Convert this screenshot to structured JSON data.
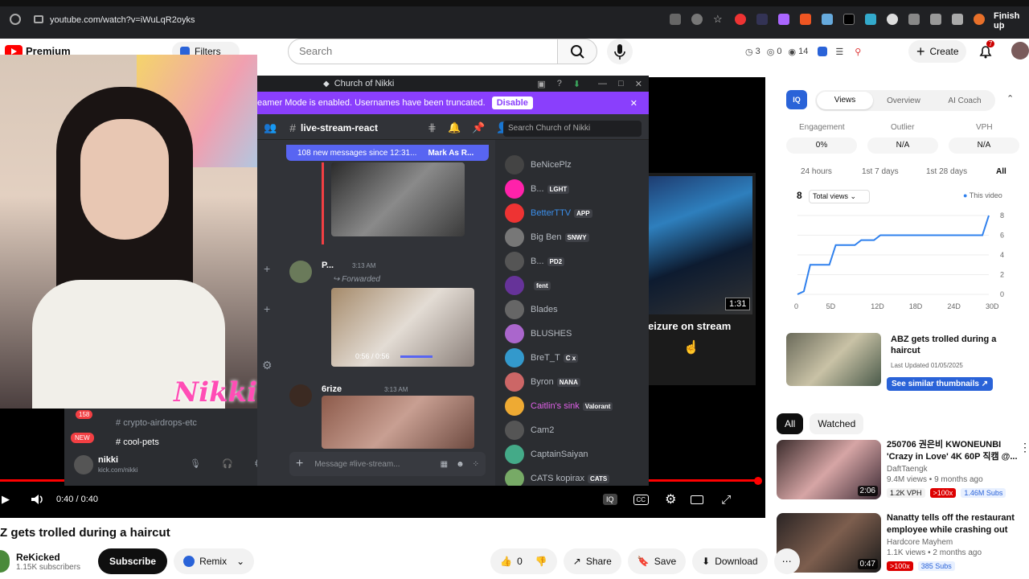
{
  "browser": {
    "url": "youtube.com/watch?v=iWuLqR2oyks",
    "finish_label": "Finish up"
  },
  "youtube": {
    "logo": "Premium",
    "filters_label": "Filters",
    "search_placeholder": "Search",
    "stats": [
      "3",
      "0",
      "14"
    ],
    "create_label": "Create",
    "bell_count": "7"
  },
  "player": {
    "time": "0:40 / 0:40",
    "related_title": "eizure on stream",
    "related_duration": "1:31"
  },
  "discord": {
    "server": "Church of Nikki",
    "banner_text": "eamer Mode is enabled. Usernames have been truncated.",
    "banner_button": "Disable",
    "channel": "live-stream-react",
    "search_placeholder": "Search Church of Nikki",
    "new_messages": "108 new messages since 12:31...",
    "mark_as_read": "Mark As R...",
    "messages": [
      {
        "author": "P...",
        "time": "3:13 AM",
        "note": "Forwarded",
        "video_time": "0:56 / 0:56"
      },
      {
        "author": "6rize",
        "time": "3:13 AM"
      }
    ],
    "input_placeholder": "Message #live-stream...",
    "members": [
      {
        "name": "BeNicePlz",
        "tag": "",
        "color": "#b5bac1"
      },
      {
        "name": "B...",
        "tag": "LGHT",
        "color": "#b5bac1"
      },
      {
        "name": "BetterTTV",
        "tag": "APP",
        "color": "#3b8eea"
      },
      {
        "name": "Big Ben",
        "tag": "SNWY",
        "color": "#b5bac1"
      },
      {
        "name": "B...",
        "tag": "PD2",
        "color": "#b5bac1"
      },
      {
        "name": "",
        "tag": "fent",
        "color": "#b5bac1"
      },
      {
        "name": "Blades",
        "tag": "",
        "color": "#b5bac1"
      },
      {
        "name": "BLUSHES",
        "tag": "",
        "color": "#b5bac1"
      },
      {
        "name": "BreT_T",
        "tag": "C x",
        "color": "#b5bac1"
      },
      {
        "name": "Byron",
        "tag": "NANA",
        "color": "#b5bac1"
      },
      {
        "name": "Caitlin's sink",
        "tag": "Valorant",
        "color": "#e061e8"
      },
      {
        "name": "Cam2",
        "tag": "",
        "color": "#b5bac1"
      },
      {
        "name": "CaptainSaiyan",
        "tag": "",
        "color": "#b5bac1"
      },
      {
        "name": "CATS kopirax",
        "tag": "CATS",
        "color": "#b5bac1"
      }
    ],
    "sidebar_channels": [
      "crypto-airdrops-etc",
      "cool-pets"
    ],
    "badge_158": "158",
    "badge_new": "NEW",
    "user_name": "nikki",
    "user_sub": "kick.com/nikki"
  },
  "webcam": {
    "overlay_name": "Nikki"
  },
  "iq_panel": {
    "tabs": [
      "Views",
      "Overview",
      "AI Coach"
    ],
    "metric_labels": [
      "Engagement",
      "Outlier",
      "VPH"
    ],
    "metric_values": [
      "0%",
      "N/A",
      "N/A"
    ],
    "ranges": [
      "24 hours",
      "1st 7 days",
      "1st 28 days",
      "All"
    ],
    "total_count": "8",
    "total_select": "Total views",
    "legend": "This video"
  },
  "chart_data": {
    "type": "line",
    "x_ticks": [
      "0",
      "5D",
      "12D",
      "18D",
      "24D",
      "30D"
    ],
    "y_ticks": [
      0,
      2,
      4,
      6,
      8
    ],
    "ylim": [
      0,
      8
    ],
    "series": [
      {
        "name": "This video",
        "x": [
          0,
          1,
          2,
          5,
          6,
          9,
          10,
          12,
          13,
          29,
          30
        ],
        "y": [
          0,
          0.3,
          3,
          3,
          5,
          5,
          5.5,
          5.5,
          6,
          6,
          8
        ]
      }
    ]
  },
  "similar": {
    "title": "ABZ gets trolled during a haircut",
    "updated": "Last Updated 01/05/2025",
    "button": "See similar thumbnails"
  },
  "chips": [
    "All",
    "Watched"
  ],
  "recommendations": [
    {
      "title": "250706 권은비 KWONEUNBI 'Crazy in Love' 4K 60P 직캠 @...",
      "channel": "DaftTaengk",
      "meta": "9.4M views • 9 months ago",
      "vph": "1.2K VPH",
      "outlier": ">100x",
      "subs": "1.46M Subs",
      "duration": "2:06"
    },
    {
      "title": "Nanatty tells off the restaurant employee while crashing out",
      "channel": "Hardcore Mayhem",
      "meta": "1.1K views • 2 months ago",
      "vph": "",
      "outlier": ">100x",
      "subs": "385 Subs",
      "duration": "0:47"
    }
  ],
  "video": {
    "title": "Z gets trolled during a haircut",
    "channel": "ReKicked",
    "subs": "1.15K subscribers",
    "subscribe": "Subscribe",
    "remix": "Remix",
    "likes": "0",
    "share": "Share",
    "save": "Save",
    "download": "Download"
  },
  "colors": {
    "youtube_red": "#ff0000",
    "discord_purple": "#8a3ffc",
    "blurple": "#5865f2",
    "chart_blue": "#2f80ed"
  }
}
